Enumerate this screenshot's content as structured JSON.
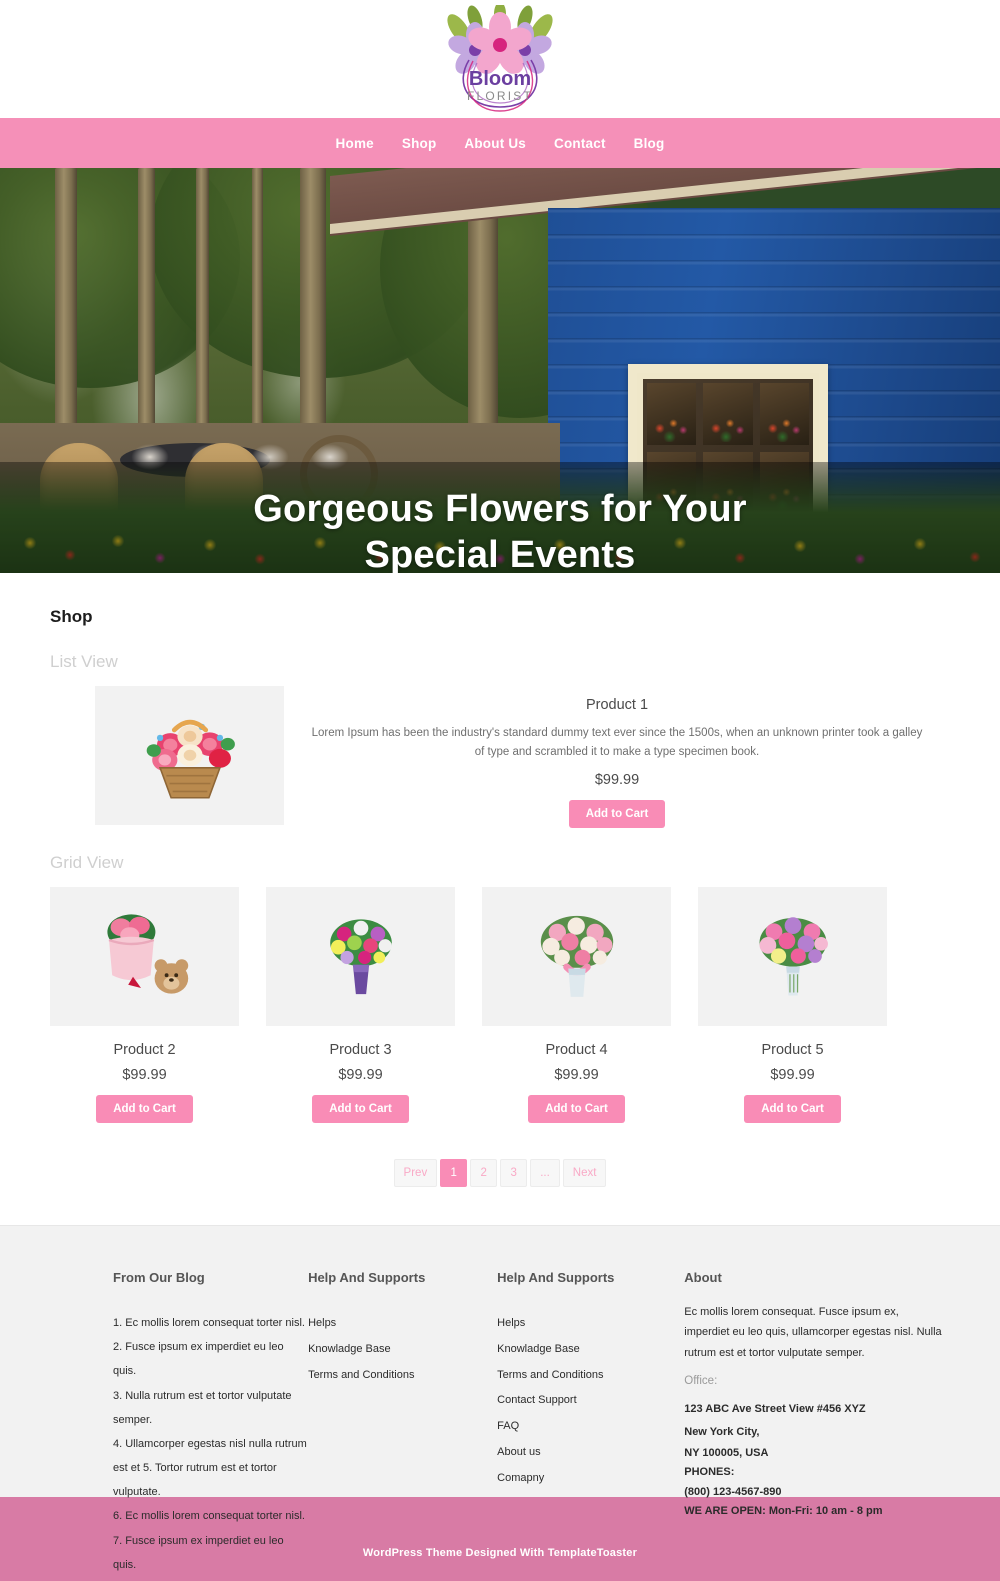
{
  "brand": {
    "name": "Bloom",
    "tagline": "FLORIST",
    "logo_icon": "flower-wreath-logo",
    "accent_pink": "#f590b8",
    "button_pink": "#f98cb6",
    "bottom_bar_pink": "#d87ba5",
    "logo_text_color": "#6b3fa0"
  },
  "nav": {
    "items": [
      {
        "label": "Home"
      },
      {
        "label": "Shop"
      },
      {
        "label": "About Us"
      },
      {
        "label": "Contact"
      },
      {
        "label": "Blog"
      }
    ]
  },
  "hero": {
    "title_line1": "Gorgeous Flowers for Your",
    "title_line2": "Special Events",
    "image_alt": "blue garden shed with flower boxes, patio chairs and spring flower beds"
  },
  "shop": {
    "heading": "Shop",
    "list_view_label": "List View",
    "grid_view_label": "Grid View",
    "add_to_cart_label": "Add to Cart",
    "list_product": {
      "name": "Product 1",
      "description": "Lorem Ipsum has been the industry's standard dummy text ever since the 1500s, when an unknown printer took a galley of type and scrambled it to make a type specimen book.",
      "price": "$99.99",
      "image_alt": "flower basket with roses"
    },
    "grid_products": [
      {
        "name": "Product 2",
        "price": "$99.99",
        "image_alt": "pink bouquet with teddy bear"
      },
      {
        "name": "Product 3",
        "price": "$99.99",
        "image_alt": "mixed flower bouquet in purple vase"
      },
      {
        "name": "Product 4",
        "price": "$99.99",
        "image_alt": "pink rose arrangement in glass vase"
      },
      {
        "name": "Product 5",
        "price": "$99.99",
        "image_alt": "pink and purple bouquet in clear vase"
      }
    ]
  },
  "pagination": {
    "prev_label": "Prev",
    "next_label": "Next",
    "pages": [
      "1",
      "2",
      "3",
      "..."
    ],
    "active_page": "1"
  },
  "footer": {
    "blog": {
      "heading": "From Our Blog",
      "items": [
        "1. Ec mollis lorem consequat torter nisl.",
        "2. Fusce ipsum ex imperdiet eu leo quis.",
        "3. Nulla rutrum est et tortor vulputate semper.",
        "4. Ullamcorper egestas nisl nulla rutrum est et 5. Tortor rutrum est et tortor vulputate.",
        "6. Ec mollis lorem consequat torter nisl.",
        "7. Fusce ipsum ex imperdiet eu leo quis."
      ]
    },
    "help_1": {
      "heading": "Help And Supports",
      "links": [
        "Helps",
        "Knowladge Base",
        "Terms and Conditions"
      ]
    },
    "help_2": {
      "heading": "Help And Supports",
      "links": [
        "Helps",
        "Knowladge Base",
        "Terms and Conditions",
        "Contact Support",
        "FAQ",
        "About us",
        "Comapny"
      ]
    },
    "about": {
      "heading": "About",
      "text": "Ec mollis lorem consequat. Fusce ipsum ex, imperdiet eu leo quis, ullamcorper egestas nisl. Nulla rutrum est et tortor vulputate semper.",
      "office_label": "Office:",
      "address_line1": "123 ABC Ave Street View #456 XYZ",
      "address_line2": "New York City,",
      "address_line3": "NY 100005, USA",
      "phones_label": "PHONES:",
      "phone": "(800) 123-4567-890",
      "open_label": "WE ARE OPEN:",
      "open_hours": "Mon-Fri: 10 am - 8 pm"
    }
  },
  "bottom_bar": {
    "text": "WordPress Theme Designed With TemplateToaster"
  }
}
